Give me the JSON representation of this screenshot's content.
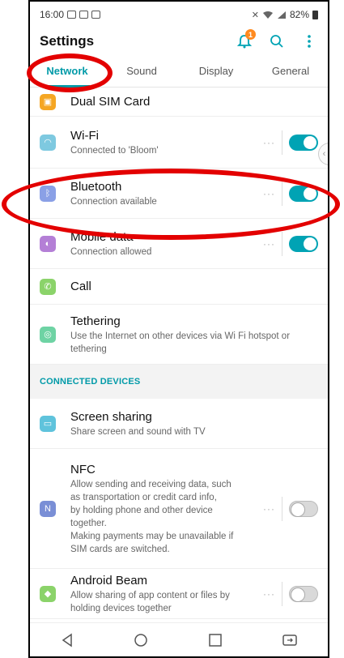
{
  "status": {
    "time": "16:00",
    "battery": "82%"
  },
  "appbar": {
    "title": "Settings",
    "notification_count": "1"
  },
  "tabs": [
    {
      "label": "Network",
      "active": true
    },
    {
      "label": "Sound",
      "active": false
    },
    {
      "label": "Display",
      "active": false
    },
    {
      "label": "General",
      "active": false
    }
  ],
  "items": {
    "dual_sim": {
      "title": "Dual SIM Card"
    },
    "wifi": {
      "title": "Wi-Fi",
      "subtitle": "Connected to 'Bloom'",
      "toggle": true
    },
    "bluetooth": {
      "title": "Bluetooth",
      "subtitle": "Connection available",
      "toggle": true
    },
    "mobile_data": {
      "title": "Mobile data",
      "subtitle": "Connection allowed",
      "toggle": true
    },
    "call": {
      "title": "Call"
    },
    "tethering": {
      "title": "Tethering",
      "subtitle": "Use the Internet on other devices via Wi Fi hotspot or tethering"
    }
  },
  "section_connected": "CONNECTED DEVICES",
  "connected": {
    "screen_sharing": {
      "title": "Screen sharing",
      "subtitle": "Share screen and sound with TV"
    },
    "nfc": {
      "title": "NFC",
      "subtitle_lines": [
        "Allow sending and receiving data, such",
        "as transportation or credit card info,",
        "by holding phone and other device",
        "together.",
        "Making payments may be unavailable if",
        "SIM cards are switched."
      ],
      "toggle": false
    },
    "android_beam": {
      "title": "Android Beam",
      "subtitle": "Allow sharing of app content or files by holding devices together",
      "toggle": false
    }
  },
  "colors": {
    "accent": "#00a3b4",
    "annotation": "#e30000",
    "notification_badge": "#ff8a1f"
  },
  "icons": {
    "dual_sim": "sim-card-icon",
    "wifi": "wifi-icon",
    "bluetooth": "bluetooth-icon",
    "mobile_data": "mobile-data-icon",
    "call": "phone-icon",
    "tethering": "hotspot-icon",
    "screen_sharing": "screen-share-icon",
    "nfc": "nfc-icon",
    "android_beam": "android-icon"
  }
}
